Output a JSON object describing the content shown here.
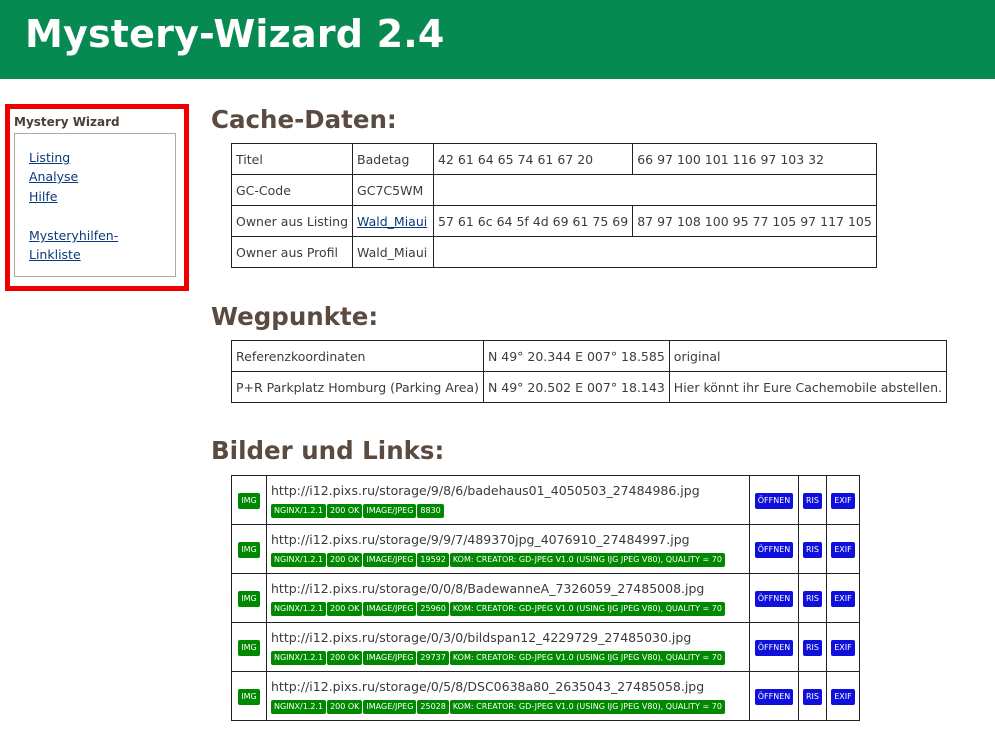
{
  "app_title": "Mystery-Wizard 2.4",
  "sidebar": {
    "title": "Mystery Wizard",
    "links": [
      "Listing",
      "Analyse",
      "Hilfe",
      "Mysteryhilfen-",
      "Linkliste"
    ]
  },
  "sections": {
    "cache": "Cache-Daten:",
    "waypoints": "Wegpunkte:",
    "images": "Bilder und Links:"
  },
  "cache_data": {
    "rows": [
      {
        "label": "Titel",
        "value": "Badetag",
        "hex": "42 61 64 65 74 61 67 20",
        "dec": "66 97 100 101 116 97 103 32"
      },
      {
        "label": "GC-Code",
        "value": "GC7C5WM"
      },
      {
        "label": "Owner aus Listing",
        "value": "Wald_Miaui",
        "hex": "57 61 6c 64 5f 4d 69 61 75 69",
        "dec": "87 97 108 100 95 77 105 97 117 105"
      },
      {
        "label": "Owner aus Profil",
        "value": "Wald_Miaui"
      }
    ]
  },
  "waypoints": [
    {
      "name": "Referenzkoordinaten",
      "coords": "N 49° 20.344 E 007° 18.585",
      "note": "original"
    },
    {
      "name": "P+R Parkplatz Homburg (Parking Area)",
      "coords": "N 49° 20.502 E 007° 18.143",
      "note": "Hier könnt ihr Eure Cachemobile abstellen."
    }
  ],
  "images": {
    "img_label": "IMG",
    "open_label": "ÖFFNEN",
    "ris_label": "RIS",
    "exif_label": "EXIF",
    "rows": [
      {
        "url": "http://i12.pixs.ru/storage/9/8/6/badehaus01_4050503_27484986.jpg",
        "server": "NGINX/1.2.1",
        "status": "200 OK",
        "type": "IMAGE/JPEG",
        "size": "8830",
        "comment": ""
      },
      {
        "url": "http://i12.pixs.ru/storage/9/9/7/489370jpg_4076910_27484997.jpg",
        "server": "NGINX/1.2.1",
        "status": "200 OK",
        "type": "IMAGE/JPEG",
        "size": "19592",
        "comment": "KOM: CREATOR: GD-JPEG V1.0 (USING IJG JPEG V80), QUALITY = 70"
      },
      {
        "url": "http://i12.pixs.ru/storage/0/0/8/BadewanneA_7326059_27485008.jpg",
        "server": "NGINX/1.2.1",
        "status": "200 OK",
        "type": "IMAGE/JPEG",
        "size": "25960",
        "comment": "KOM: CREATOR: GD-JPEG V1.0 (USING IJG JPEG V80), QUALITY = 70"
      },
      {
        "url": "http://i12.pixs.ru/storage/0/3/0/bildspan12_4229729_27485030.jpg",
        "server": "NGINX/1.2.1",
        "status": "200 OK",
        "type": "IMAGE/JPEG",
        "size": "29737",
        "comment": "KOM: CREATOR: GD-JPEG V1.0 (USING IJG JPEG V80), QUALITY = 70"
      },
      {
        "url": "http://i12.pixs.ru/storage/0/5/8/DSC0638a80_2635043_27485058.jpg",
        "server": "NGINX/1.2.1",
        "status": "200 OK",
        "type": "IMAGE/JPEG",
        "size": "25028",
        "comment": "KOM: CREATOR: GD-JPEG V1.0 (USING IJG JPEG V80), QUALITY = 70"
      }
    ]
  },
  "colors": {
    "header_bg": "#068a52",
    "sidebar_border": "#ee0000",
    "tag_green": "#008800",
    "button_blue": "#1010dd"
  }
}
